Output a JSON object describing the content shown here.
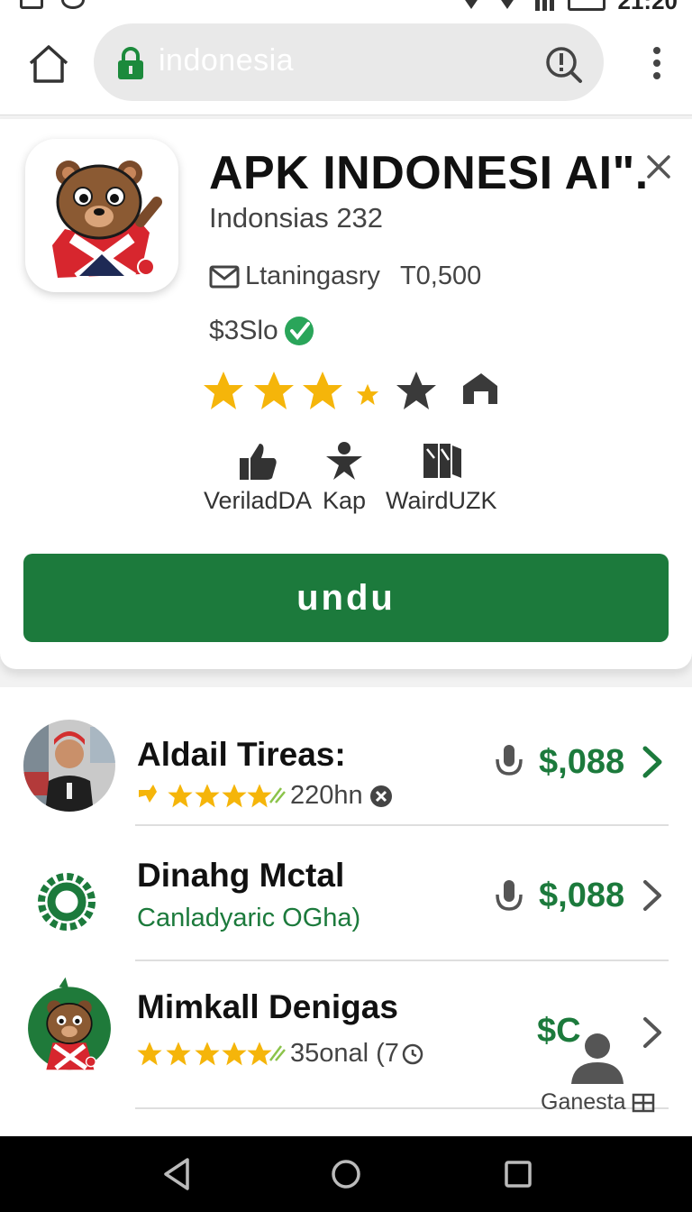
{
  "status_bar": {
    "time": "21:20"
  },
  "browser": {
    "url": "indonesia"
  },
  "app": {
    "title": "APK INDONESI AI\".",
    "developer": "Indonsias 232",
    "category": "Ltaningasry",
    "downloads": "T0,500",
    "price": "$3Slo",
    "badges": [
      {
        "label": "VeriladDA",
        "icon": "thumbs-up-icon"
      },
      {
        "label": "Kap",
        "icon": "person-star-icon"
      },
      {
        "label": "WairdUZK",
        "icon": "books-icon"
      }
    ],
    "install_label": "undu",
    "colors": {
      "brand_green": "#1c7a3c",
      "star_gold": "#f5b50a",
      "icon_red": "#d32f2f"
    }
  },
  "list": [
    {
      "title": "Aldail Tireas:",
      "subtitle": "220hn",
      "price": "$,088"
    },
    {
      "title": "Dinahg Mctal",
      "subtitle": "Canladyaric OGha)",
      "price": "$,088"
    },
    {
      "title": "Mimkall Denigas",
      "subtitle": "35onal (7",
      "price": "$C"
    }
  ],
  "corner_label": "Ganesta"
}
